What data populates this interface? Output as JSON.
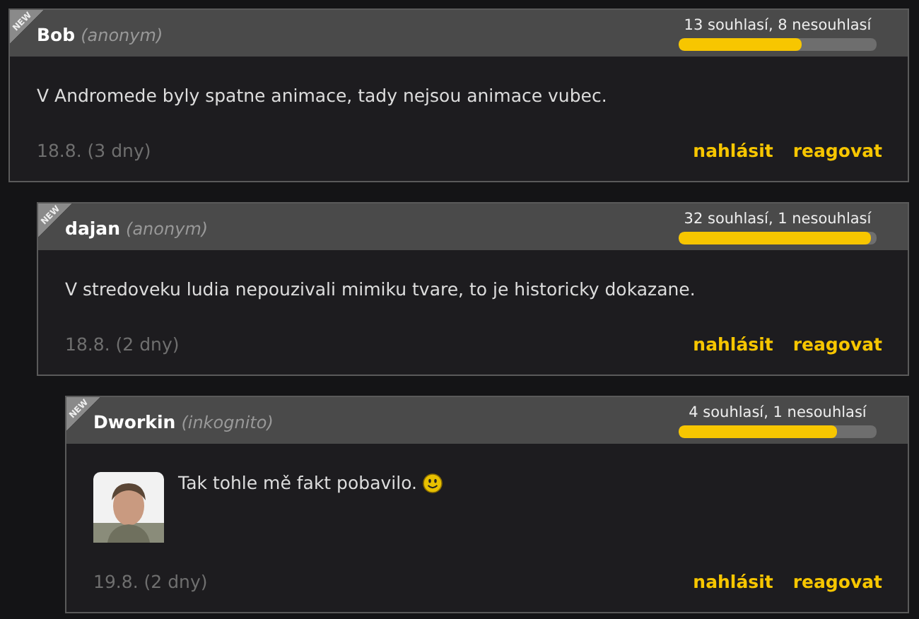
{
  "comments": [
    {
      "badge": "NEW",
      "is_new": true,
      "name": "Bob",
      "alias": "(anonym)",
      "votes": "13 souhlasí, 8 nesouhlasí",
      "level": 0.62,
      "text": "V Andromede byly spatne animace, tady nejsou animace vubec.",
      "date": "18.8. (3 dny)",
      "actions": [
        "nahlásit",
        "reagovat"
      ],
      "children": [
        {
          "badge": "NEW",
          "is_new": true,
          "name": "dajan",
          "alias": "(anonym)",
          "votes": "32 souhlasí, 1 nesouhlasí",
          "level": 0.97,
          "text": "V stredoveku ludia nepouzivali mimiku tvare, to je historicky dokazane.",
          "date": "18.8. (2 dny)",
          "actions": [
            "nahlásit",
            "reagovat"
          ],
          "children": [
            {
              "badge": "NEW",
              "is_new": true,
              "name": "Dworkin",
              "alias": "(inkognito)",
              "votes": "4 souhlasí, 1 nesouhlasí",
              "level": 0.8,
              "text": "Tak tohle mě fakt pobavilo.",
              "emoticon": true,
              "date": "19.8. (2 dny)",
              "actions": [
                "nahlásit",
                "reagovat"
              ]
            }
          ]
        }
      ]
    }
  ]
}
